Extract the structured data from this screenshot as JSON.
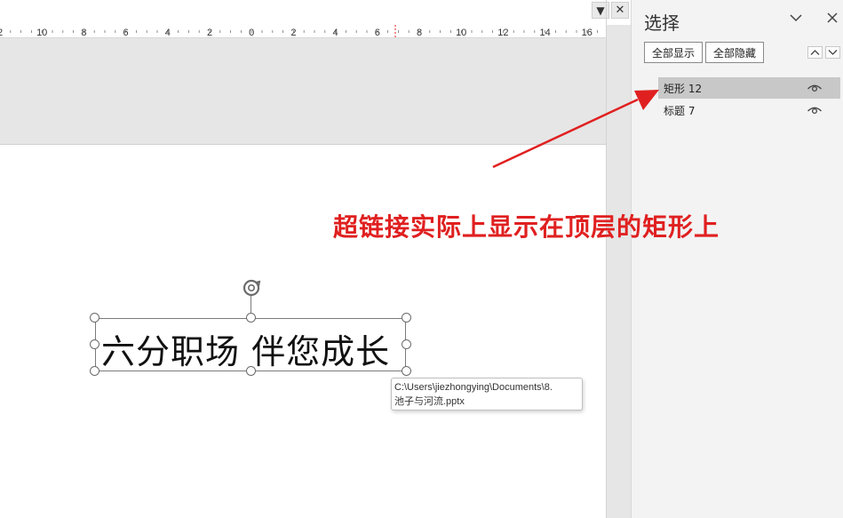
{
  "editor": {
    "menu_dropdown_glyph": "▼",
    "close_glyph": "✕",
    "ruler": {
      "labels": [
        "2",
        "10",
        "8",
        "6",
        "4",
        "2",
        "0",
        "2",
        "4",
        "6",
        "8",
        "10",
        "12",
        "14",
        "16"
      ],
      "cursor_color": "#e02020"
    },
    "textbox_text": "六分职场 伴您成长",
    "tooltip_lines": [
      "C:\\Users\\jiezhongying\\Documents\\8.",
      "池子与河流.pptx"
    ]
  },
  "selection_pane": {
    "title": "选择",
    "show_all_label": "全部显示",
    "hide_all_label": "全部隐藏",
    "items": [
      {
        "label": "矩形 12",
        "selected": true
      },
      {
        "label": "标题 7",
        "selected": false
      }
    ]
  },
  "annotation": {
    "text": "超链接实际上显示在顶层的矩形上",
    "color": "#e02020"
  },
  "colors": {
    "selected_row": "#c8c8c8",
    "pane_bg": "#f3f3f3",
    "workspace_bg": "#e6e6e6"
  }
}
